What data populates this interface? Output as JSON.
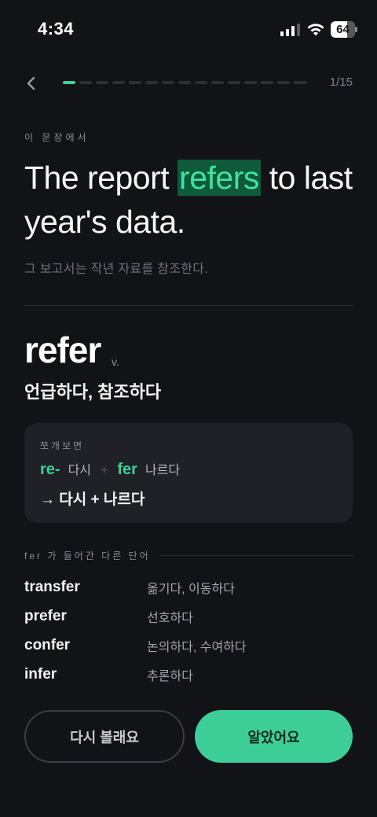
{
  "status_bar": {
    "time": "4:34",
    "battery": "64"
  },
  "header": {
    "page_count": "1/15",
    "progress": {
      "current": 1,
      "total": 15
    }
  },
  "sentence": {
    "section_label": "이 문장에서",
    "before": "The report ",
    "highlight": "refers",
    "after": " to last year's data.",
    "translation": "그 보고서는 작년 자료를 참조한다."
  },
  "word": {
    "term": "refer",
    "pos": "v.",
    "meaning": "언급하다, 참조하다"
  },
  "breakdown": {
    "label": "쪼개보면",
    "parts": [
      {
        "root": "re-",
        "meaning": "다시"
      },
      {
        "root": "fer",
        "meaning": "나르다"
      }
    ],
    "plus": "+",
    "result": "→ 다시 + 나르다"
  },
  "related": {
    "label": "fer 가 들어간 다른 단어",
    "items": [
      {
        "word": "transfer",
        "meaning": "옮기다, 이동하다"
      },
      {
        "word": "prefer",
        "meaning": "선호하다"
      },
      {
        "word": "confer",
        "meaning": "논의하다, 수여하다"
      },
      {
        "word": "infer",
        "meaning": "추론하다"
      }
    ]
  },
  "actions": {
    "again_label": "다시 볼래요",
    "got_it_label": "알았어요"
  },
  "colors": {
    "accent": "#3ecf98",
    "highlight_bg": "#0f5a3b",
    "background": "#121316"
  }
}
